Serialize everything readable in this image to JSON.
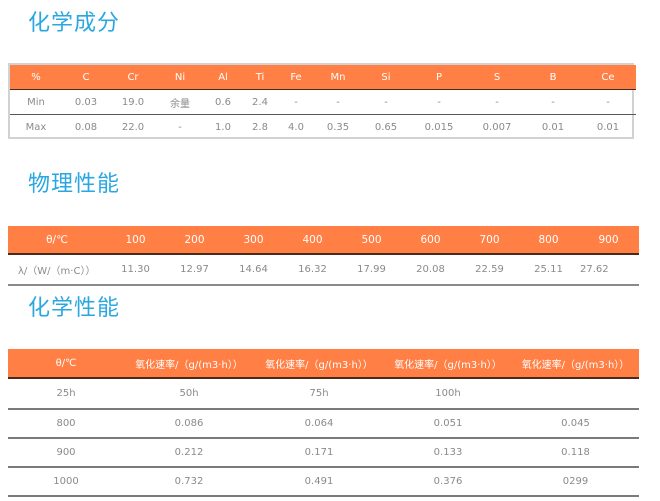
{
  "colors": {
    "title": "#2aa7e0",
    "header_bg": "#ff7f45",
    "header_text": "#ffffff",
    "cell_text": "#8a8a8a"
  },
  "composition": {
    "title": "化学成分",
    "headers": [
      "%",
      "C",
      "Cr",
      "Ni",
      "Al",
      "Ti",
      "Fe",
      "Mn",
      "Si",
      "P",
      "S",
      "B",
      "Ce"
    ],
    "rows": [
      [
        "Min",
        "0.03",
        "19.0",
        "余量",
        "0.6",
        "2.4",
        "-",
        "-",
        "-",
        "-",
        "-",
        "-",
        "-"
      ],
      [
        "Max",
        "0.08",
        "22.0",
        "-",
        "1.0",
        "2.8",
        "4.0",
        "0.35",
        "0.65",
        "0.015",
        "0.007",
        "0.01",
        "0.01"
      ]
    ]
  },
  "physical": {
    "title": "物理性能",
    "headers": [
      "θ/℃",
      "100",
      "200",
      "300",
      "400",
      "500",
      "600",
      "700",
      "800",
      "900"
    ],
    "rows": [
      [
        "λ/（W/（m·C））",
        "11.30",
        "12.97",
        "14.64",
        "16.32",
        "17.99",
        "20.08",
        "22.59",
        "25.11",
        "27.62"
      ]
    ]
  },
  "chemical": {
    "title": "化学性能",
    "headers": [
      "θ/℃",
      "氧化速率/（g/(m3·h））",
      "氧化速率/（g/(m3·h））",
      "氧化速率/（g/(m3·h））",
      "氧化速率/（g/(m3·h））"
    ],
    "rows": [
      [
        "25h",
        "50h",
        "75h",
        "100h",
        ""
      ],
      [
        "800",
        "0.086",
        "0.064",
        "0.051",
        "0.045"
      ],
      [
        "900",
        "0.212",
        "0.171",
        "0.133",
        "0.118"
      ],
      [
        "1000",
        "0.732",
        "0.491",
        "0.376",
        "0299"
      ]
    ]
  }
}
